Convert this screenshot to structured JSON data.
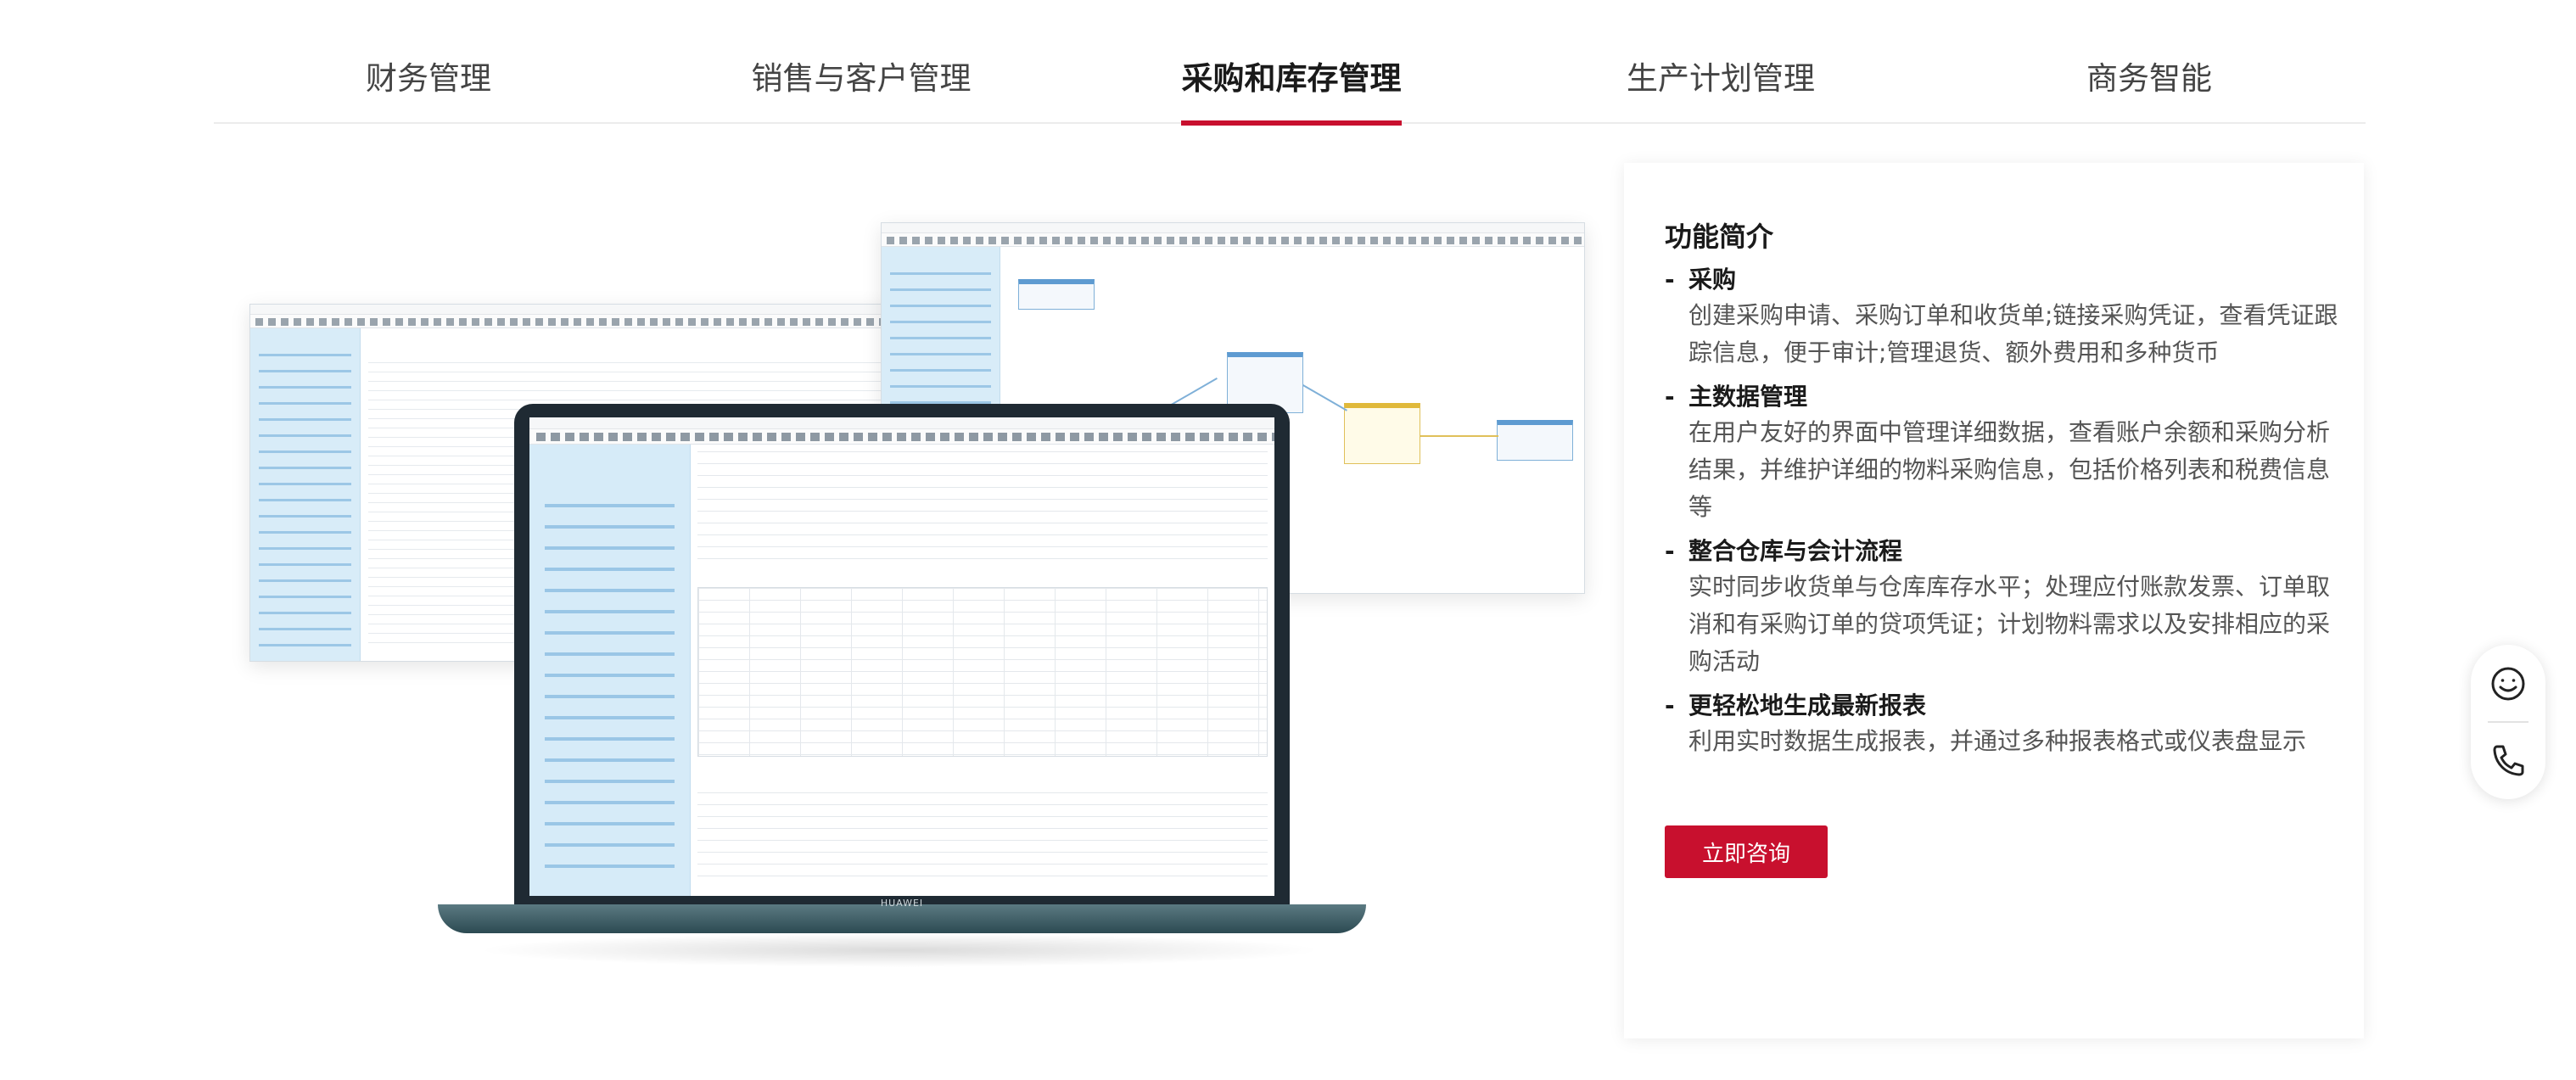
{
  "tabs": [
    {
      "label": "财务管理"
    },
    {
      "label": "销售与客户管理"
    },
    {
      "label": "采购和库存管理",
      "active": true
    },
    {
      "label": "生产计划管理"
    },
    {
      "label": "商务智能"
    }
  ],
  "card": {
    "title": "功能简介",
    "features": [
      {
        "heading": "采购",
        "body": "创建采购申请、采购订单和收货单;链接采购凭证，查看凭证跟踪信息，便于审计;管理退货、额外费用和多种货币"
      },
      {
        "heading": "主数据管理",
        "body": "在用户友好的界面中管理详细数据，查看账户余额和采购分析结果，并维护详细的物料采购信息，包括价格列表和税费信息等"
      },
      {
        "heading": "整合仓库与会计流程",
        "body": "实时同步收货单与仓库库存水平；处理应付账款发票、订单取消和有采购订单的贷项凭证；计划物料需求以及安排相应的采购活动"
      },
      {
        "heading": "更轻松地生成最新报表",
        "body": "利用实时数据生成报表，并通过多种报表格式或仪表盘显示"
      }
    ],
    "cta_label": "立即咨询"
  },
  "illustration": {
    "laptop_brand": "HUAWEI"
  },
  "float_widget": {
    "icons": [
      "smiley-icon",
      "phone-icon"
    ]
  },
  "colors": {
    "accent": "#c8102e",
    "sidebar_blue": "#d6ebf8",
    "laptop_body": "#2c4a52"
  }
}
